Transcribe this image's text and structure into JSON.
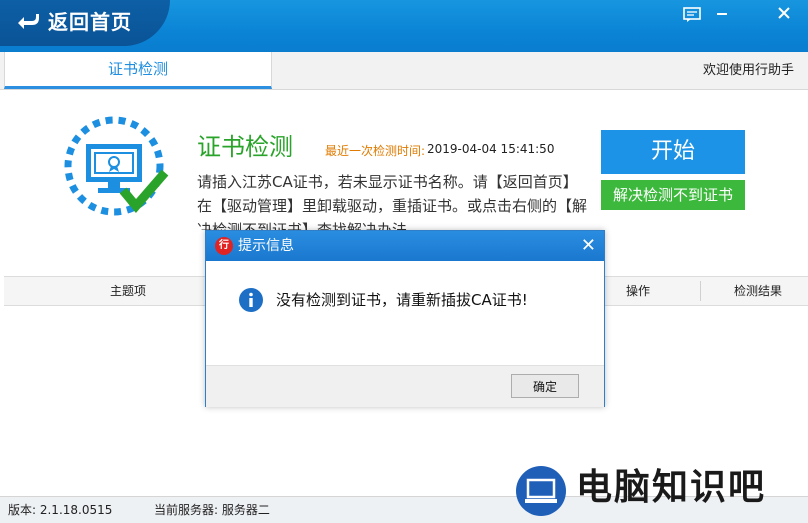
{
  "titlebar": {
    "back_label": "返回首页",
    "buttons": [
      {
        "name": "feedback-icon",
        "glyph": "☐"
      },
      {
        "name": "minimize-icon",
        "glyph": "▬"
      },
      {
        "name": "close-icon",
        "glyph": "✕"
      }
    ]
  },
  "tabs": {
    "active_label": "证书检测",
    "welcome": "欢迎使用行助手"
  },
  "main": {
    "title": "证书检测",
    "last_check_label": "最近一次检测时间:",
    "last_check_time": "2019-04-04 15:41:50",
    "description": "请插入江苏CA证书，若未显示证书名称。请【返回首页】在【驱动管理】里卸载驱动，重插证书。或点击右侧的【解决检测不到证书】查找解决办法",
    "start_button": "开始",
    "fix_button": "解决检测不到证书"
  },
  "table": {
    "columns": [
      "主题项",
      "操作",
      "检测结果"
    ]
  },
  "statusbar": {
    "version": "版本: 2.1.18.0515",
    "server": "当前服务器: 服务器二"
  },
  "watermark": {
    "text": "电脑知识吧"
  },
  "dialog": {
    "title": "提示信息",
    "close_glyph": "✕",
    "message": "没有检测到证书，请重新插拔CA证书!",
    "ok_button": "确定"
  },
  "colors": {
    "titlebar": "#0b84d6",
    "accent_blue": "#1c93e6",
    "success_green": "#3cb83c",
    "title_green": "#2aa32a",
    "timestamp_orange": "#e07b00"
  }
}
